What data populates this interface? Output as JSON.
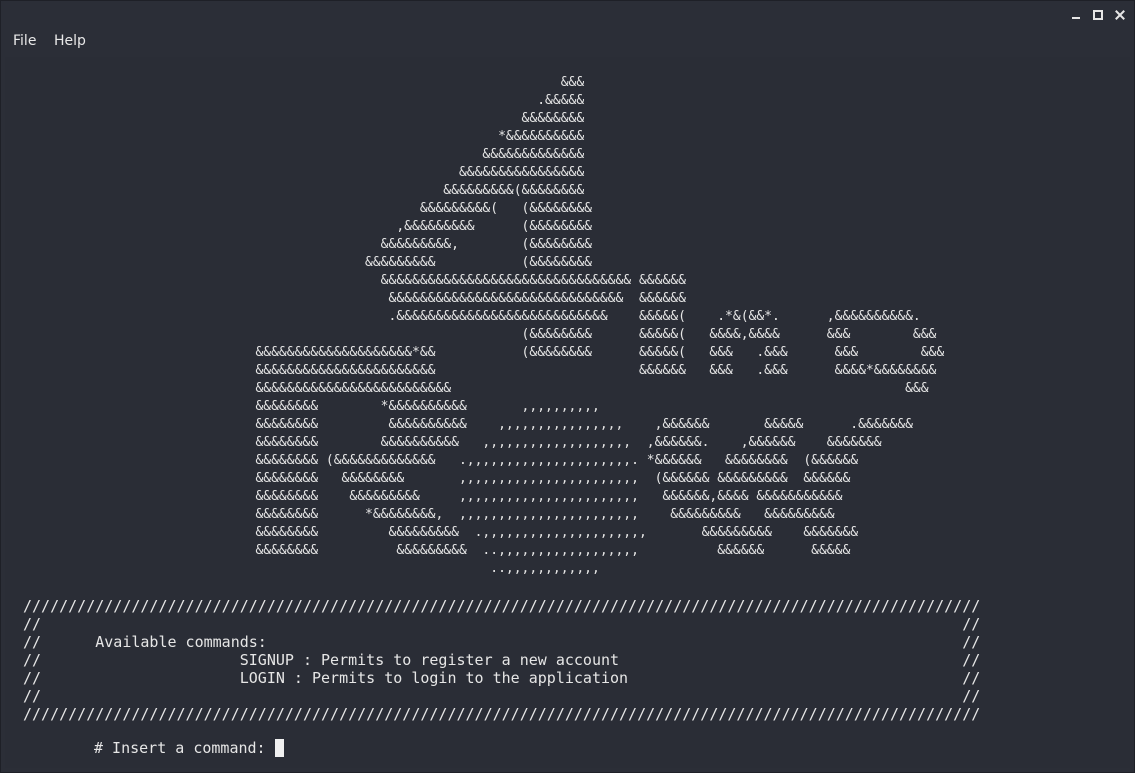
{
  "window_controls": {
    "minimize_icon": "minimize-icon",
    "maximize_icon": "maximize-icon",
    "close_icon": "close-icon"
  },
  "menu": {
    "file": "File",
    "help": "Help"
  },
  "ascii_art": "                                                                       &&&\n                                                                    .&&&&&\n                                                                  &&&&&&&&\n                                                               *&&&&&&&&&&\n                                                             &&&&&&&&&&&&&\n                                                          &&&&&&&&&&&&&&&&\n                                                        &&&&&&&&&(&&&&&&&&\n                                                     &&&&&&&&&(   (&&&&&&&&\n                                                  ,&&&&&&&&&      (&&&&&&&&\n                                                &&&&&&&&&,        (&&&&&&&&\n                                              &&&&&&&&&           (&&&&&&&&\n                                                &&&&&&&&&&&&&&&&&&&&&&&&&&&&&&&& &&&&&&\n                                                 &&&&&&&&&&&&&&&&&&&&&&&&&&&&&&  &&&&&&\n                                                 .&&&&&&&&&&&&&&&&&&&&&&&&&&&    &&&&&(    .*&(&&*.      ,&&&&&&&&&&.\n                                                                  (&&&&&&&&      &&&&&(   &&&&,&&&&      &&&        &&&\n                                &&&&&&&&&&&&&&&&&&&&*&&           (&&&&&&&&      &&&&&(   &&&   .&&&      &&&        &&&\n                                &&&&&&&&&&&&&&&&&&&&&&&                          &&&&&&   &&&   .&&&      &&&&*&&&&&&&&\n                                &&&&&&&&&&&&&&&&&&&&&&&&&                                                          &&&\n                                &&&&&&&&        *&&&&&&&&&&       ,,,,,,,,,,\n                                &&&&&&&&         &&&&&&&&&&    ,,,,,,,,,,,,,,,,    ,&&&&&&       &&&&&      .&&&&&&&\n                                &&&&&&&&        &&&&&&&&&&   ,,,,,,,,,,,,,,,,,,,  ,&&&&&&.    ,&&&&&&    &&&&&&&\n                                &&&&&&&& (&&&&&&&&&&&&&   .,,,,,,,,,,,,,,,,,,,,,. *&&&&&&   &&&&&&&&  (&&&&&&\n                                &&&&&&&&   &&&&&&&&       ,,,,,,,,,,,,,,,,,,,,,,,  (&&&&&& &&&&&&&&&  &&&&&&\n                                &&&&&&&&    &&&&&&&&&     ,,,,,,,,,,,,,,,,,,,,,,,   &&&&&&,&&&& &&&&&&&&&&&\n                                &&&&&&&&      *&&&&&&&&,  ,,,,,,,,,,,,,,,,,,,,,,,    &&&&&&&&&   &&&&&&&&&\n                                &&&&&&&&         &&&&&&&&&  .,,,,,,,,,,,,,,,,,,,,,       &&&&&&&&&    &&&&&&&\n                                &&&&&&&&          &&&&&&&&&  ..,,,,,,,,,,,,,,,,,,          &&&&&&      &&&&&\n                                                              ..,,,,,,,,,,,,",
  "banner": {
    "border_top": "//////////////////////////////////////////////////////////////////////////////////////////////////////////",
    "blank_1": "//                                                                                                      //",
    "title_line": "//      Available commands:                                                                             //",
    "signup_line": "//                      SIGNUP : Permits to register a new account                                      //",
    "login_line": "//                      LOGIN : Permits to login to the application                                     //",
    "blank_2": "//                                                                                                      //",
    "border_bottom": "//////////////////////////////////////////////////////////////////////////////////////////////////////////"
  },
  "prompt": {
    "label": "# Insert a command: ",
    "value": ""
  }
}
